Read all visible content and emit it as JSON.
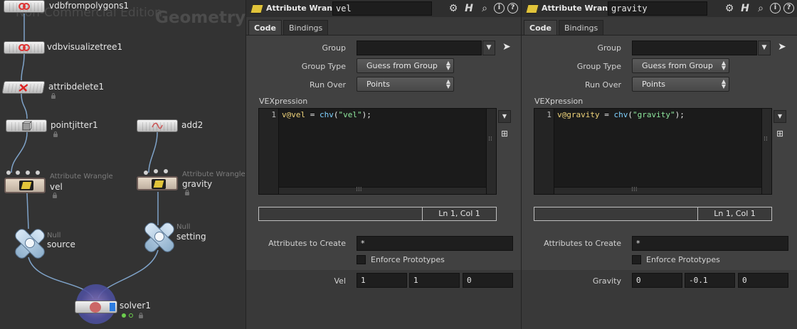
{
  "network": {
    "watermark": "Non-Commercial Edition",
    "context_label": "Geometry",
    "nodes": [
      {
        "name": "vdbfrompolygons1"
      },
      {
        "name": "vdbvisualizetree1"
      },
      {
        "name": "attribdelete1"
      },
      {
        "name": "pointjitter1"
      },
      {
        "name": "add2"
      },
      {
        "type": "Attribute Wrangle",
        "name": "vel"
      },
      {
        "type": "Attribute Wrangle",
        "name": "gravity"
      },
      {
        "type": "Null",
        "name": "source"
      },
      {
        "type": "Null",
        "name": "setting"
      },
      {
        "name": "solver1"
      }
    ]
  },
  "panes": [
    {
      "type_label": "Attribute Wrangle",
      "node_name": "vel",
      "tabs": [
        "Code",
        "Bindings"
      ],
      "group_label": "Group",
      "group_value": "",
      "group_type_label": "Group Type",
      "group_type_value": "Guess from Group",
      "run_over_label": "Run Over",
      "run_over_value": "Points",
      "vex_label": "VEXpression",
      "line_no": "1",
      "code": {
        "attr": "v@vel",
        "op": " = ",
        "fn": "chv",
        "open": "(",
        "str": "\"vel\"",
        "close": ");"
      },
      "cursor_status": "Ln 1, Col 1",
      "attr_create_label": "Attributes to Create",
      "attr_create_value": "*",
      "enforce_label": "Enforce Prototypes",
      "vec_label": "Vel",
      "vec": [
        "1",
        "1",
        "0"
      ]
    },
    {
      "type_label": "Attribute Wrangle",
      "node_name": "gravity",
      "tabs": [
        "Code",
        "Bindings"
      ],
      "group_label": "Group",
      "group_value": "",
      "group_type_label": "Group Type",
      "group_type_value": "Guess from Group",
      "run_over_label": "Run Over",
      "run_over_value": "Points",
      "vex_label": "VEXpression",
      "line_no": "1",
      "code": {
        "attr": "v@gravity",
        "op": " = ",
        "fn": "chv",
        "open": "(",
        "str": "\"gravity\"",
        "close": ");"
      },
      "cursor_status": "Ln 1, Col 1",
      "attr_create_label": "Attributes to Create",
      "attr_create_value": "*",
      "enforce_label": "Enforce Prototypes",
      "vec_label": "Gravity",
      "vec": [
        "0",
        "-0.1",
        "0"
      ]
    }
  ],
  "toolbar_icons": [
    "gear-icon",
    "hscript-help-icon",
    "search-icon",
    "info-icon",
    "help-icon"
  ],
  "colors": {
    "accent_wrangle": "#e1c43a",
    "solver": "#4f4f9e",
    "null_node": "#8fb0cc"
  }
}
